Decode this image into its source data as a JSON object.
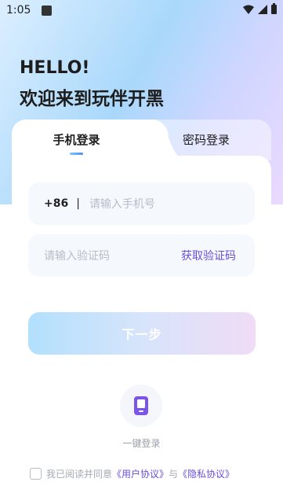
{
  "status_bar": {
    "time": "1:05"
  },
  "greeting": {
    "line1": "HELLO!",
    "line2": "欢迎来到玩伴开黑"
  },
  "tabs": [
    {
      "label": "手机登录",
      "active": true
    },
    {
      "label": "密码登录",
      "active": false
    }
  ],
  "phone_input": {
    "country_code": "+86",
    "separator": "|",
    "placeholder": "请输入手机号"
  },
  "code_input": {
    "placeholder": "请输入验证码",
    "get_code_label": "获取验证码"
  },
  "next_button": {
    "label": "下一步"
  },
  "one_key_login": {
    "label": "一键登录"
  },
  "agreement": {
    "prefix": "我已阅读并同意",
    "user_agreement": "《用户协议》",
    "and": "与",
    "privacy_policy": "《隐私协议》",
    "checked": false
  },
  "colors": {
    "accent": "#6a4fd6",
    "text_primary": "#1d1d1d",
    "placeholder": "#b7bcc6",
    "input_bg": "#f5f8fd"
  }
}
